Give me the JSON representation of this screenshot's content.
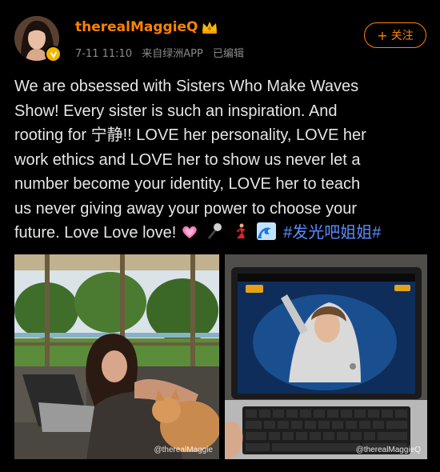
{
  "header": {
    "username": "therealMaggieQ",
    "date": "7-11 11:10",
    "source": "来自绿洲APP",
    "edited": "已编辑",
    "follow_label": "关注",
    "follow_plus": "+"
  },
  "post": {
    "lines": [
      "We are obsessed with Sisters Who Make Waves",
      "Show! Every sister is such an inspiration. And",
      "rooting for 宁静!! LOVE her personality, LOVE her",
      "work ethics and LOVE her to show us never let a",
      "number become your identity, LOVE her to teach",
      "us never giving away your power to choose your"
    ],
    "last_line": "future. Love Love love!",
    "emojis": [
      "heart-emoji",
      "microphone-emoji",
      "dancer-emoji",
      "wave-emoji"
    ],
    "hashtag": "#发光吧姐姐#"
  },
  "images": {
    "left_watermark": "@therealMaggie",
    "right_watermark": "@therealMaggieQ"
  },
  "colors": {
    "background": "#000000",
    "username": "#ff8200",
    "hashtag": "#5b8cff",
    "meta": "#8a8a8a",
    "verified_badge": "#f2b705"
  }
}
